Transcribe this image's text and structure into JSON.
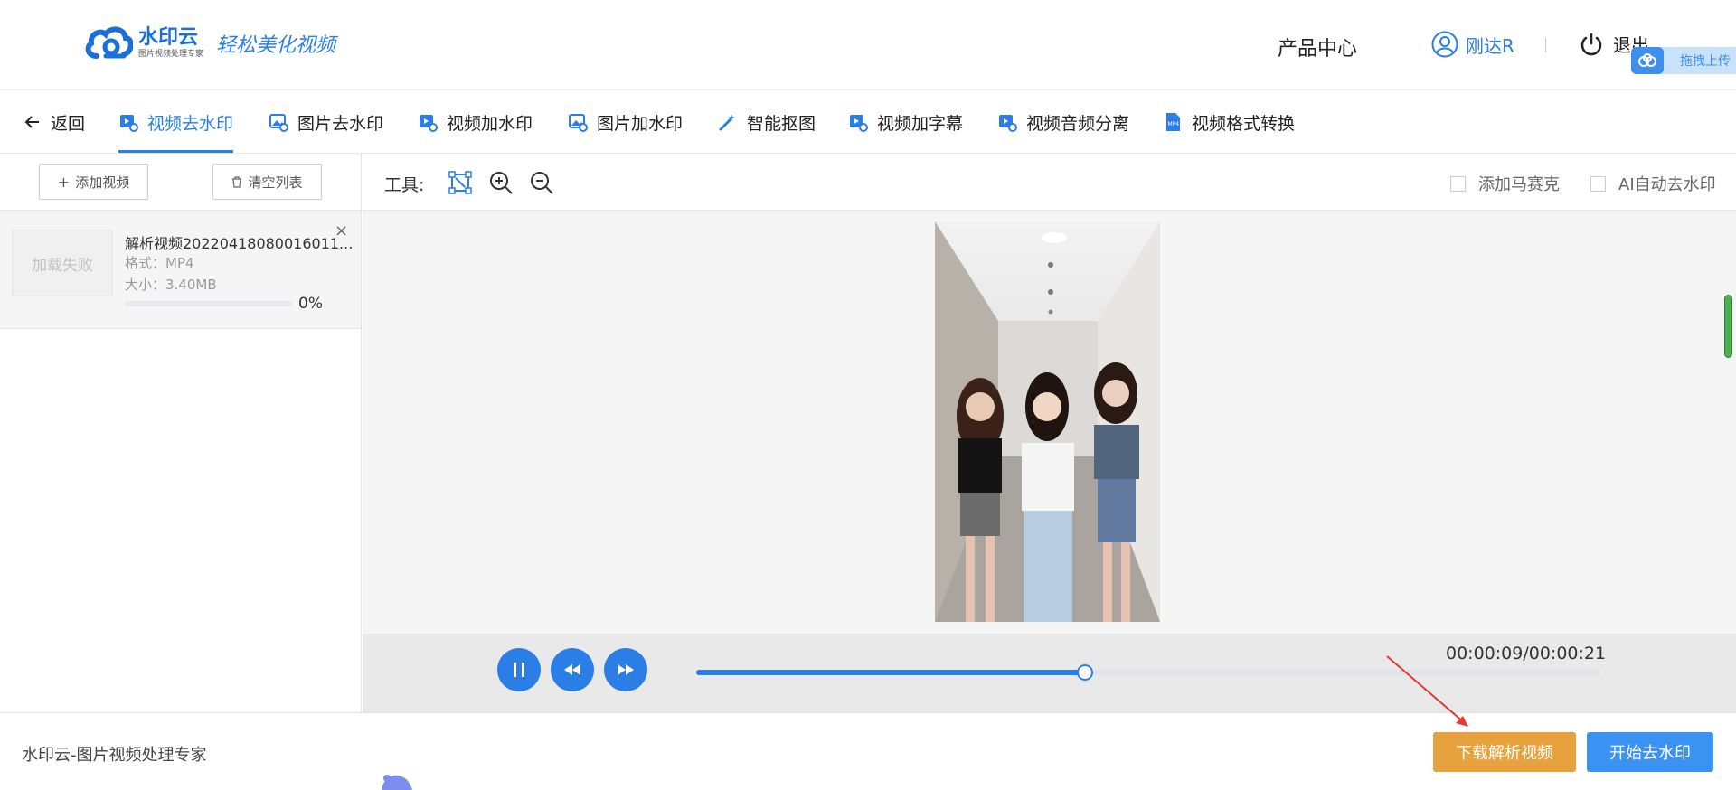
{
  "header": {
    "logo_name": "水印云",
    "logo_sub": "图片视频处理专家",
    "slogan": "轻松美化视频",
    "product_center": "产品中心",
    "user_name": "刚达R",
    "logout": "退出",
    "upload_float": "拖拽上传"
  },
  "nav": {
    "back": "返回",
    "items": [
      {
        "label": "视频去水印",
        "icon": "video-icon",
        "active": true
      },
      {
        "label": "图片去水印",
        "icon": "image-icon"
      },
      {
        "label": "视频加水印",
        "icon": "video-icon"
      },
      {
        "label": "图片加水印",
        "icon": "image-icon"
      },
      {
        "label": "智能抠图",
        "icon": "magic-wand-icon"
      },
      {
        "label": "视频加字幕",
        "icon": "video-icon"
      },
      {
        "label": "视频音频分离",
        "icon": "video-icon"
      },
      {
        "label": "视频格式转换",
        "icon": "mp4-file-icon"
      }
    ]
  },
  "left": {
    "add_video": "添加视频",
    "clear_list": "清空列表",
    "file": {
      "thumb_text": "加载失败",
      "name": "解析视频20220418080016011...",
      "format": "格式：MP4",
      "size": "大小：3.40MB",
      "progress_text": "0%",
      "progress": 0
    }
  },
  "tools": {
    "label": "工具:",
    "add_mosaic": "添加马赛克",
    "ai_remove": "AI自动去水印"
  },
  "player": {
    "time": "00:00:09/00:00:21",
    "progress": 0.43
  },
  "footer": {
    "text": "水印云-图片视频处理专家",
    "download": "下载解析视频",
    "start": "开始去水印"
  },
  "colors": {
    "accent": "#2a7ee6",
    "download": "#e8a23d",
    "start": "#3a92f2"
  }
}
